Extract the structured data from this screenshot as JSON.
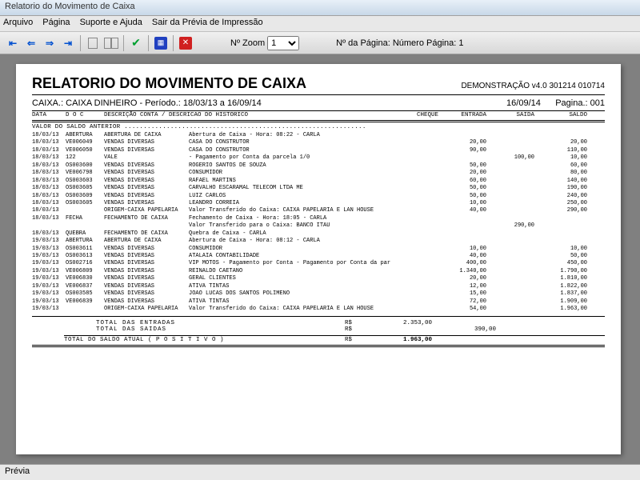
{
  "window_title": "Relatorio do Movimento de Caixa",
  "menu": {
    "arquivo": "Arquivo",
    "pagina": "Página",
    "suporte": "Suporte e Ajuda",
    "sair": "Sair da Prévia de Impressão"
  },
  "toolbar": {
    "zoom_label": "Nº Zoom",
    "zoom_value": "1",
    "page_label": "Nº da Página: Número Página: 1"
  },
  "report": {
    "title": "RELATORIO DO MOVIMENTO DE CAIXA",
    "demo": "DEMONSTRAÇÃO v4.0 301214 010714",
    "caixa": "CAIXA.: CAIXA DINHEIRO -  Período.: 18/03/13 a 16/09/14",
    "date": "16/09/14",
    "page": "Pagina.: 001",
    "headers": {
      "data": "DATA",
      "doc": "D O C",
      "desc": "DESCRIÇÃO CONTA / DESCRICAO DO HISTORICO",
      "cheque": "CHEQUE",
      "entrada": "ENTRADA",
      "saida": "SAIDA",
      "saldo": "SALDO"
    },
    "saldo_anterior": "VALOR DO SALDO ANTERIOR ...............................................................",
    "rows": [
      {
        "date": "18/03/13",
        "doc": "ABERTURA",
        "d1": "ABERTURA DE CAIXA",
        "d2": "Abertura de Caixa - Hora: 08:22 - CARLA",
        "entrada": "",
        "saida": "",
        "saldo": ""
      },
      {
        "date": "18/03/13",
        "doc": "VE006049",
        "d1": "VENDAS DIVERSAS",
        "d2": "CASA DO CONSTRUTOR",
        "entrada": "20,00",
        "saida": "",
        "saldo": "20,00"
      },
      {
        "date": "18/03/13",
        "doc": "VE006050",
        "d1": "VENDAS DIVERSAS",
        "d2": "CASA DO CONSTRUTOR",
        "entrada": "90,00",
        "saida": "",
        "saldo": "110,00"
      },
      {
        "date": "18/03/13",
        "doc": "122",
        "d1": "VALE",
        "d2": "- Pagamento por Conta da parcela 1/0",
        "entrada": "",
        "saida": "100,00",
        "saldo": "10,00"
      },
      {
        "date": "18/03/13",
        "doc": "OS003600",
        "d1": "VENDAS DIVERSAS",
        "d2": "ROGERIO SANTOS DE SOUZA",
        "entrada": "50,00",
        "saida": "",
        "saldo": "60,00"
      },
      {
        "date": "18/03/13",
        "doc": "VE006798",
        "d1": "VENDAS DIVERSAS",
        "d2": "CONSUMIDOR",
        "entrada": "20,00",
        "saida": "",
        "saldo": "80,00"
      },
      {
        "date": "18/03/13",
        "doc": "OS003603",
        "d1": "VENDAS DIVERSAS",
        "d2": "RAFAEL MARTINS",
        "entrada": "60,00",
        "saida": "",
        "saldo": "140,00"
      },
      {
        "date": "18/03/13",
        "doc": "OS003605",
        "d1": "VENDAS DIVERSAS",
        "d2": "CARVALHO ESCARAMAL TELECOM LTDA ME",
        "entrada": "50,00",
        "saida": "",
        "saldo": "190,00"
      },
      {
        "date": "18/03/13",
        "doc": "OS003609",
        "d1": "VENDAS DIVERSAS",
        "d2": "LUIZ CARLOS",
        "entrada": "50,00",
        "saida": "",
        "saldo": "240,00"
      },
      {
        "date": "18/03/13",
        "doc": "OS003605",
        "d1": "VENDAS DIVERSAS",
        "d2": "LEANDRO CORREIA",
        "entrada": "10,00",
        "saida": "",
        "saldo": "250,00"
      },
      {
        "date": "18/03/13",
        "doc": "",
        "d1": "ORIGEM-CAIXA PAPELARIA",
        "d2": "Valor Transferido do Caixa: CAIXA PAPELARIA E LAN HOUSE",
        "entrada": "40,00",
        "saida": "",
        "saldo": "290,00"
      },
      {
        "date": "18/03/13",
        "doc": "FECHA",
        "d1": "FECHAMENTO DE CAIXA",
        "d2": "Fechamento de Caixa - Hora: 18:05 - CARLA",
        "entrada": "",
        "saida": "",
        "saldo": ""
      },
      {
        "date": "",
        "doc": "",
        "d1": "",
        "d2": "Valor Transferido para o Caixa: BANCO ITAU",
        "entrada": "",
        "saida": "290,00",
        "saldo": ""
      },
      {
        "date": "18/03/13",
        "doc": "QUEBRA",
        "d1": "FECHAMENTO DE CAIXA",
        "d2": "Quebra de Caixa - CARLA",
        "entrada": "",
        "saida": "",
        "saldo": ""
      },
      {
        "date": "19/03/13",
        "doc": "ABERTURA",
        "d1": "ABERTURA DE CAIXA",
        "d2": "Abertura de Caixa - Hora: 08:12 - CARLA",
        "entrada": "",
        "saida": "",
        "saldo": ""
      },
      {
        "date": "19/03/13",
        "doc": "OS003611",
        "d1": "VENDAS DIVERSAS",
        "d2": "CONSUMIDOR",
        "entrada": "10,00",
        "saida": "",
        "saldo": "10,00"
      },
      {
        "date": "19/03/13",
        "doc": "OS003613",
        "d1": "VENDAS DIVERSAS",
        "d2": "ATALAIA CONTABILIDADE",
        "entrada": "40,00",
        "saida": "",
        "saldo": "50,00"
      },
      {
        "date": "19/03/13",
        "doc": "OS002716",
        "d1": "VENDAS DIVERSAS",
        "d2": "VIP MOTOS - Pagamento por Conta - Pagamento por Conta da par",
        "entrada": "400,00",
        "saida": "",
        "saldo": "450,00"
      },
      {
        "date": "19/03/13",
        "doc": "VE006809",
        "d1": "VENDAS DIVERSAS",
        "d2": "REINALDO CAETANO",
        "entrada": "1.340,00",
        "saida": "",
        "saldo": "1.790,00"
      },
      {
        "date": "19/03/13",
        "doc": "VE006830",
        "d1": "VENDAS DIVERSAS",
        "d2": "GERAL CLIENTES",
        "entrada": "20,00",
        "saida": "",
        "saldo": "1.810,00"
      },
      {
        "date": "19/03/13",
        "doc": "VE006837",
        "d1": "VENDAS DIVERSAS",
        "d2": "ATIVA TINTAS",
        "entrada": "12,00",
        "saida": "",
        "saldo": "1.822,00"
      },
      {
        "date": "19/03/13",
        "doc": "OS003585",
        "d1": "VENDAS DIVERSAS",
        "d2": "JOAO LUCAS DOS SANTOS POLIMENO",
        "entrada": "15,00",
        "saida": "",
        "saldo": "1.837,00"
      },
      {
        "date": "19/03/13",
        "doc": "VE006839",
        "d1": "VENDAS DIVERSAS",
        "d2": "ATIVA TINTAS",
        "entrada": "72,00",
        "saida": "",
        "saldo": "1.909,00"
      },
      {
        "date": "19/03/13",
        "doc": "",
        "d1": "ORIGEM-CAIXA PAPELARIA",
        "d2": "Valor Transferido do Caixa: CAIXA PAPELARIA E LAN HOUSE",
        "entrada": "54,00",
        "saida": "",
        "saldo": "1.963,00"
      }
    ],
    "totals": {
      "entradas_label": "TOTAL DAS ENTRADAS",
      "entradas_cur": "R$",
      "entradas_val": "2.353,00",
      "saidas_label": "TOTAL DAS SAIDAS",
      "saidas_cur": "R$",
      "saidas_val": "390,00",
      "atual_label": "TOTAL DO SALDO ATUAL ( P O S I T I V O )",
      "atual_cur": "R$",
      "atual_val": "1.963,00"
    }
  },
  "statusbar": "Prévia"
}
